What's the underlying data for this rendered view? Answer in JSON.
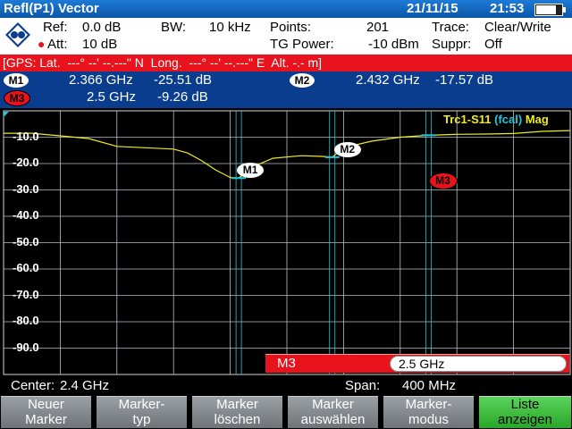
{
  "title_bar": {
    "mode": "Refl(P1) Vector",
    "date": "21/11/15",
    "time": "21:53",
    "battery_level": 0.8
  },
  "settings": {
    "ref_label": "Ref:",
    "ref_value": "0.0 dB",
    "att_label": "Att:",
    "att_value": "10 dB",
    "bw_label": "BW:",
    "bw_value": "10 kHz",
    "points_label": "Points:",
    "points_value": "201",
    "tg_label": "TG Power:",
    "tg_value": "-10 dBm",
    "trace_label": "Trace:",
    "trace_value": "Clear/Write",
    "suppr_label": "Suppr:",
    "suppr_value": "Off"
  },
  "gps": {
    "text": "[GPS: Lat.  ---° --' --.---\" N  Long.  ---° --' --.---\" E  Alt. -.- m]"
  },
  "marker_table": [
    {
      "id": "M1",
      "freq": "2.366 GHz",
      "value": "-25.51 dB",
      "style": "white"
    },
    {
      "id": "M2",
      "freq": "2.432 GHz",
      "value": "-17.57 dB",
      "style": "white"
    },
    {
      "id": "M3",
      "freq": "2.5 GHz",
      "value": "-9.26 dB",
      "style": "red"
    }
  ],
  "trace_label": {
    "name": "Trc1-S11",
    "cal": "(fcal)",
    "format": "Mag"
  },
  "marker_entry": {
    "label": "M3",
    "value": "2.5 GHz"
  },
  "footer": {
    "center_label": "Center:",
    "center_value": "2.4 GHz",
    "span_label": "Span:",
    "span_value": "400 MHz"
  },
  "softkeys": [
    {
      "line1": "Neuer",
      "line2": "Marker",
      "active": false
    },
    {
      "line1": "Marker-",
      "line2": "typ",
      "active": false
    },
    {
      "line1": "Marker",
      "line2": "löschen",
      "active": false
    },
    {
      "line1": "Marker",
      "line2": "auswählen",
      "active": false
    },
    {
      "line1": "Marker-",
      "line2": "modus",
      "active": false
    },
    {
      "line1": "Liste",
      "line2": "anzeigen",
      "active": true
    }
  ],
  "chart_data": {
    "type": "line",
    "x_unit": "GHz",
    "xlim": [
      2.2,
      2.6
    ],
    "ylim": [
      -100,
      0
    ],
    "yticks": [
      -10,
      -20,
      -30,
      -40,
      -50,
      -60,
      -70,
      -80,
      -90
    ],
    "ytick_labels": [
      "-10.0",
      "-20.0",
      "-30.0",
      "-40.0",
      "-50.0",
      "-60.0",
      "-70.0",
      "-80.0",
      "-90.0"
    ],
    "grid": true,
    "series": [
      {
        "name": "Trc1-S11",
        "color": "#f0ec1f",
        "x": [
          2.2,
          2.22,
          2.24,
          2.26,
          2.28,
          2.3,
          2.32,
          2.33,
          2.34,
          2.35,
          2.36,
          2.366,
          2.375,
          2.39,
          2.41,
          2.425,
          2.432,
          2.44,
          2.46,
          2.48,
          2.5,
          2.52,
          2.54,
          2.56,
          2.58,
          2.6
        ],
        "y": [
          -8.5,
          -8.5,
          -9.5,
          -10.5,
          -13.5,
          -14.0,
          -14.5,
          -16.0,
          -19.0,
          -22.5,
          -25.3,
          -25.5,
          -21.5,
          -18.0,
          -17.0,
          -17.3,
          -17.6,
          -14.0,
          -11.5,
          -10.0,
          -9.3,
          -8.9,
          -8.8,
          -8.6,
          -7.8,
          -7.5
        ]
      }
    ],
    "markers": [
      {
        "id": "M1",
        "x": 2.366,
        "y": -25.51
      },
      {
        "id": "M2",
        "x": 2.432,
        "y": -17.57
      },
      {
        "id": "M3",
        "x": 2.5,
        "y": -9.26
      }
    ]
  }
}
